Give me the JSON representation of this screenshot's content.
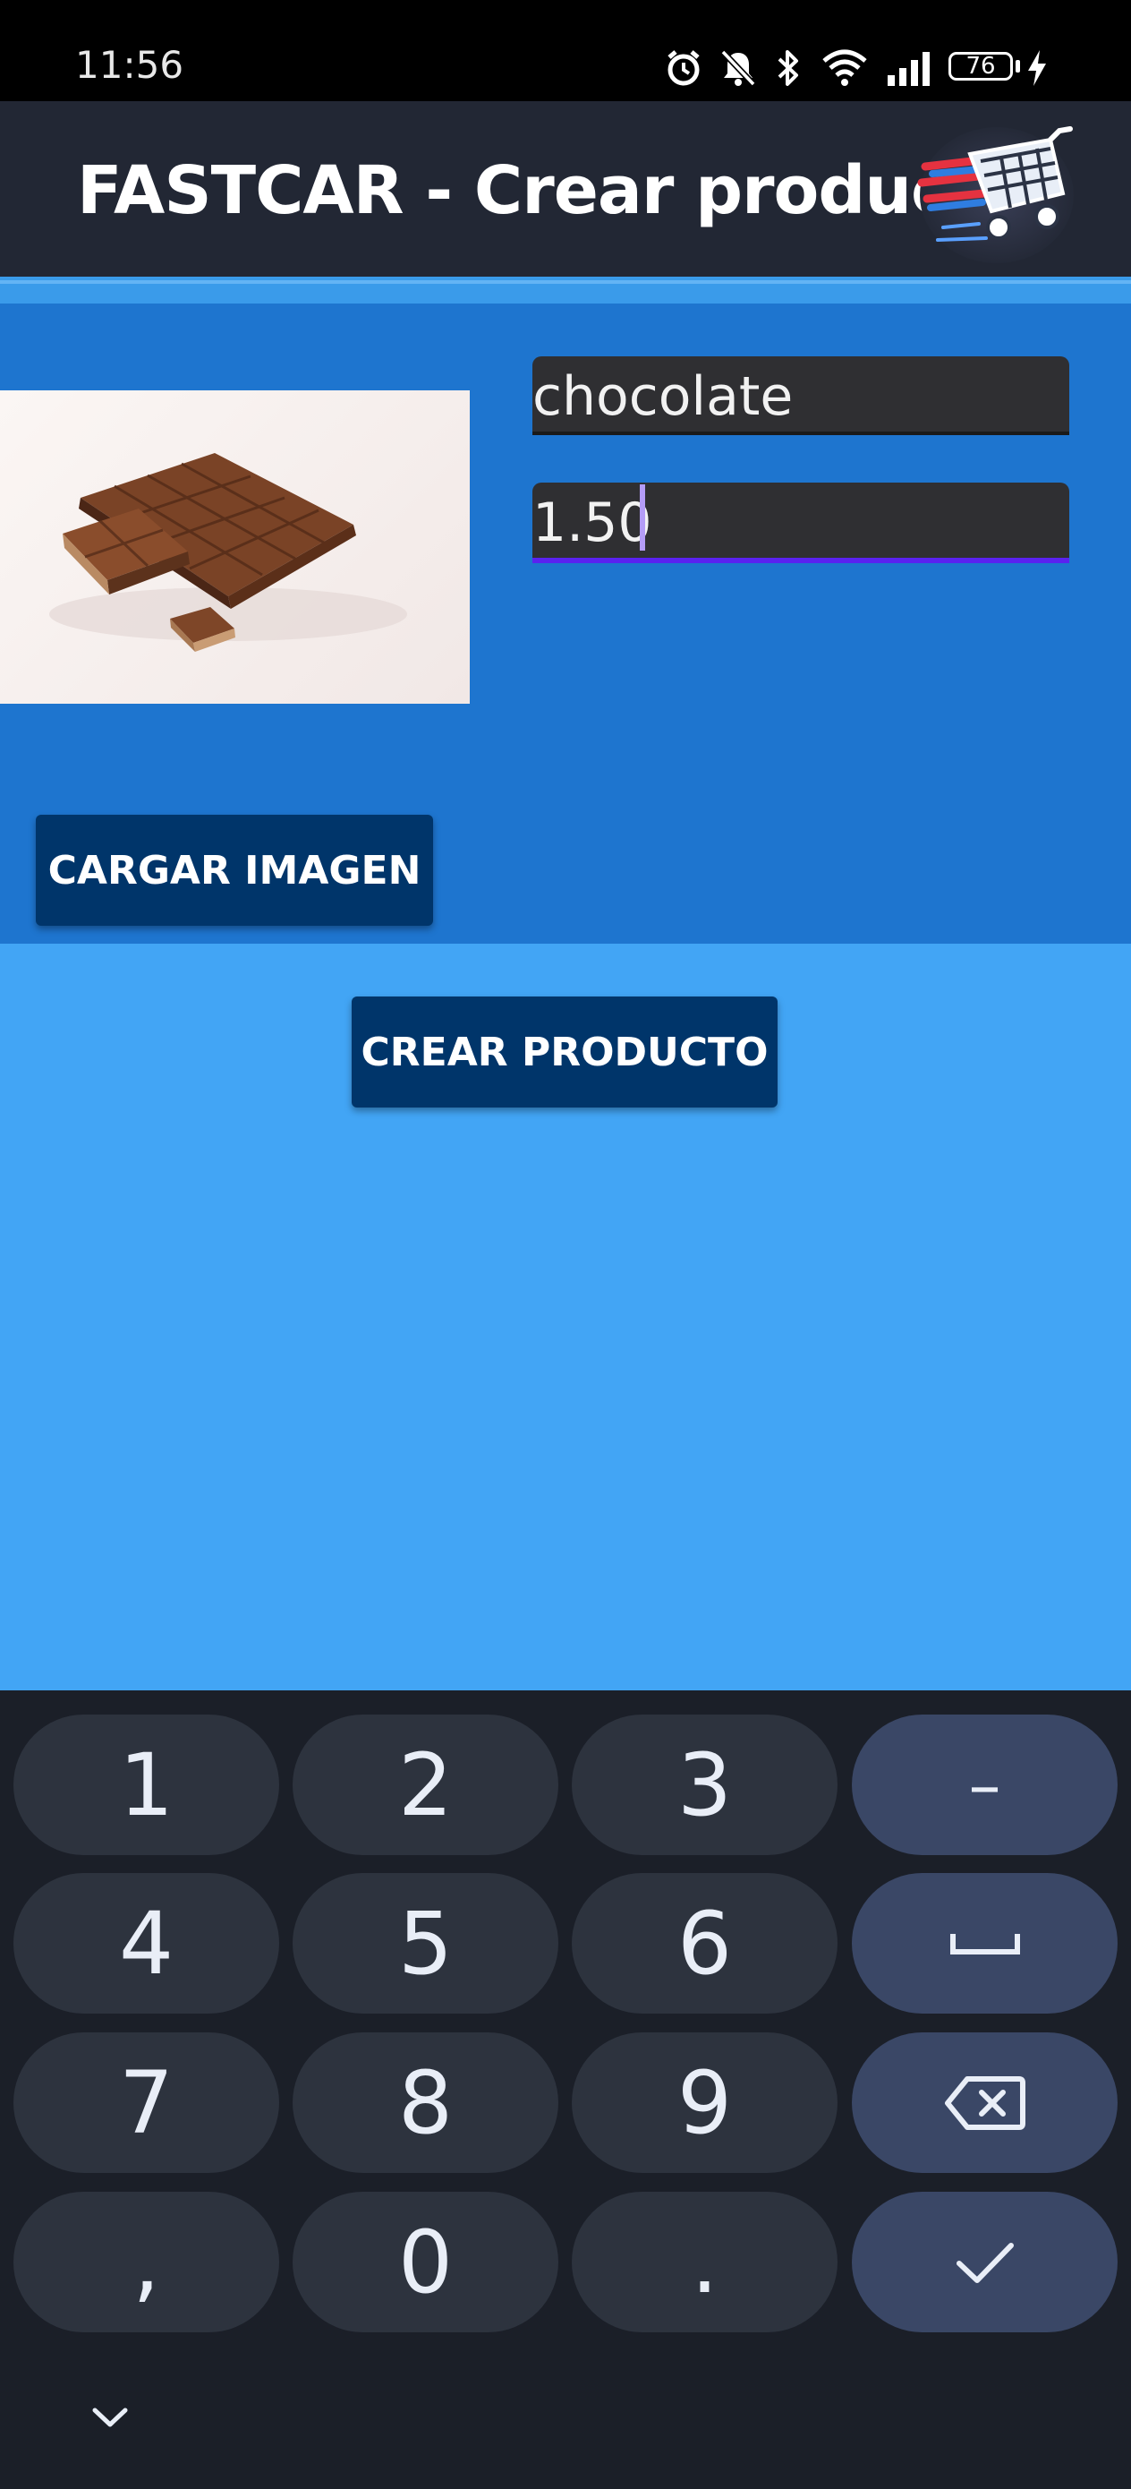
{
  "status_bar": {
    "time": "11:56",
    "battery_level": "76",
    "icons": [
      "alarm-icon",
      "notifications-muted-icon",
      "bluetooth-icon",
      "wifi-icon",
      "signal-icon",
      "battery-icon",
      "charging-icon"
    ]
  },
  "app_bar": {
    "title": "FASTCAR - Crear producto",
    "logo": "shopping-cart-logo"
  },
  "form": {
    "product_image": "chocolate-bar-image",
    "name_value": "chocolate",
    "price_value": "1.50",
    "load_image_label": "CARGAR IMAGEN"
  },
  "actions": {
    "create_product_label": "CREAR PRODUCTO"
  },
  "keyboard": {
    "keys": [
      "1",
      "2",
      "3",
      "–",
      "4",
      "5",
      "6",
      "space",
      "7",
      "8",
      "9",
      "backspace",
      ",",
      "0",
      ".",
      "done"
    ],
    "hide_icon": "chevron-down-icon"
  },
  "colors": {
    "app_bar": "#222734",
    "form_panel": "#1e75cf",
    "content_area": "#42a5f5",
    "button": "#00356a",
    "focused_underline": "#5a22f0",
    "keyboard_bg": "#1b1f28",
    "key": "#2d333e",
    "function_key": "#3a4766"
  }
}
